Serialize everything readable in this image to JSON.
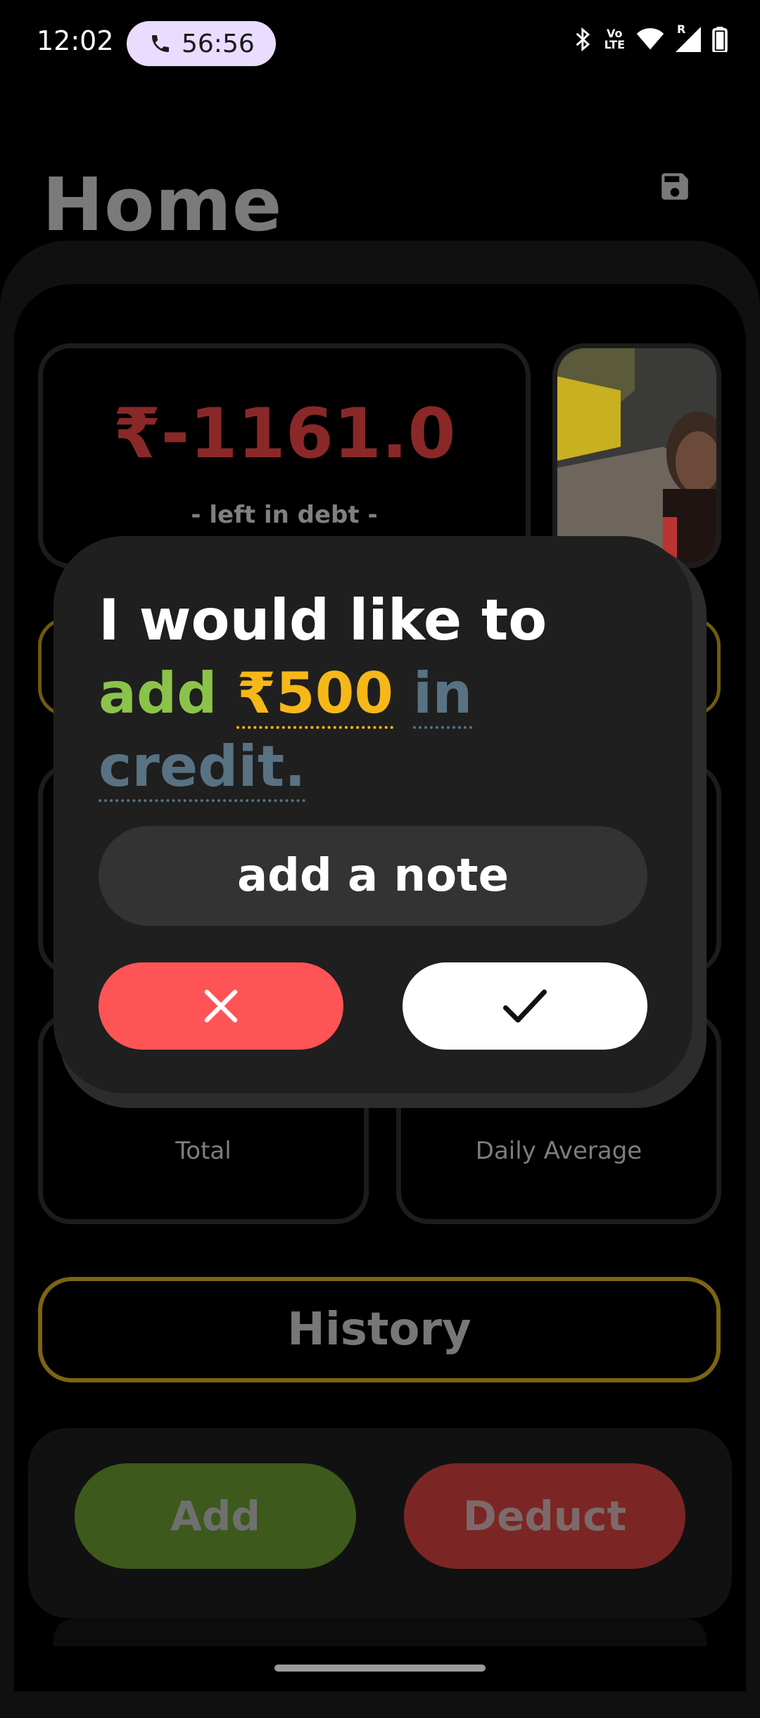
{
  "status_bar": {
    "time": "12:02",
    "call_timer": "56:56",
    "volte": "Vo\nLTE",
    "network_indicator": "R"
  },
  "header": {
    "title": "Home"
  },
  "balance": {
    "value": "₹-1161.0",
    "subtitle": "- left in debt -",
    "value_color": "#8a2828"
  },
  "stats": {
    "total_label": "Total",
    "daily_avg_label": "Daily Average"
  },
  "history": {
    "label": "History"
  },
  "actions": {
    "add_label": "Add",
    "deduct_label": "Deduct"
  },
  "dialog": {
    "line_prefix": "I would like to",
    "verb": "add",
    "amount": "₹500",
    "type": "in credit.",
    "note_label": "add a note",
    "cancel_icon": "close-icon",
    "confirm_icon": "check-icon",
    "colors": {
      "verb": "#8bc34a",
      "amount": "#f6b818",
      "type": "#587283",
      "cancel": "#ff5455",
      "confirm": "#ffffff"
    }
  },
  "accent_colors": {
    "gold_border": "#7b6512",
    "add_button": "#3d5a1c",
    "deduct_button": "#7c2525"
  }
}
